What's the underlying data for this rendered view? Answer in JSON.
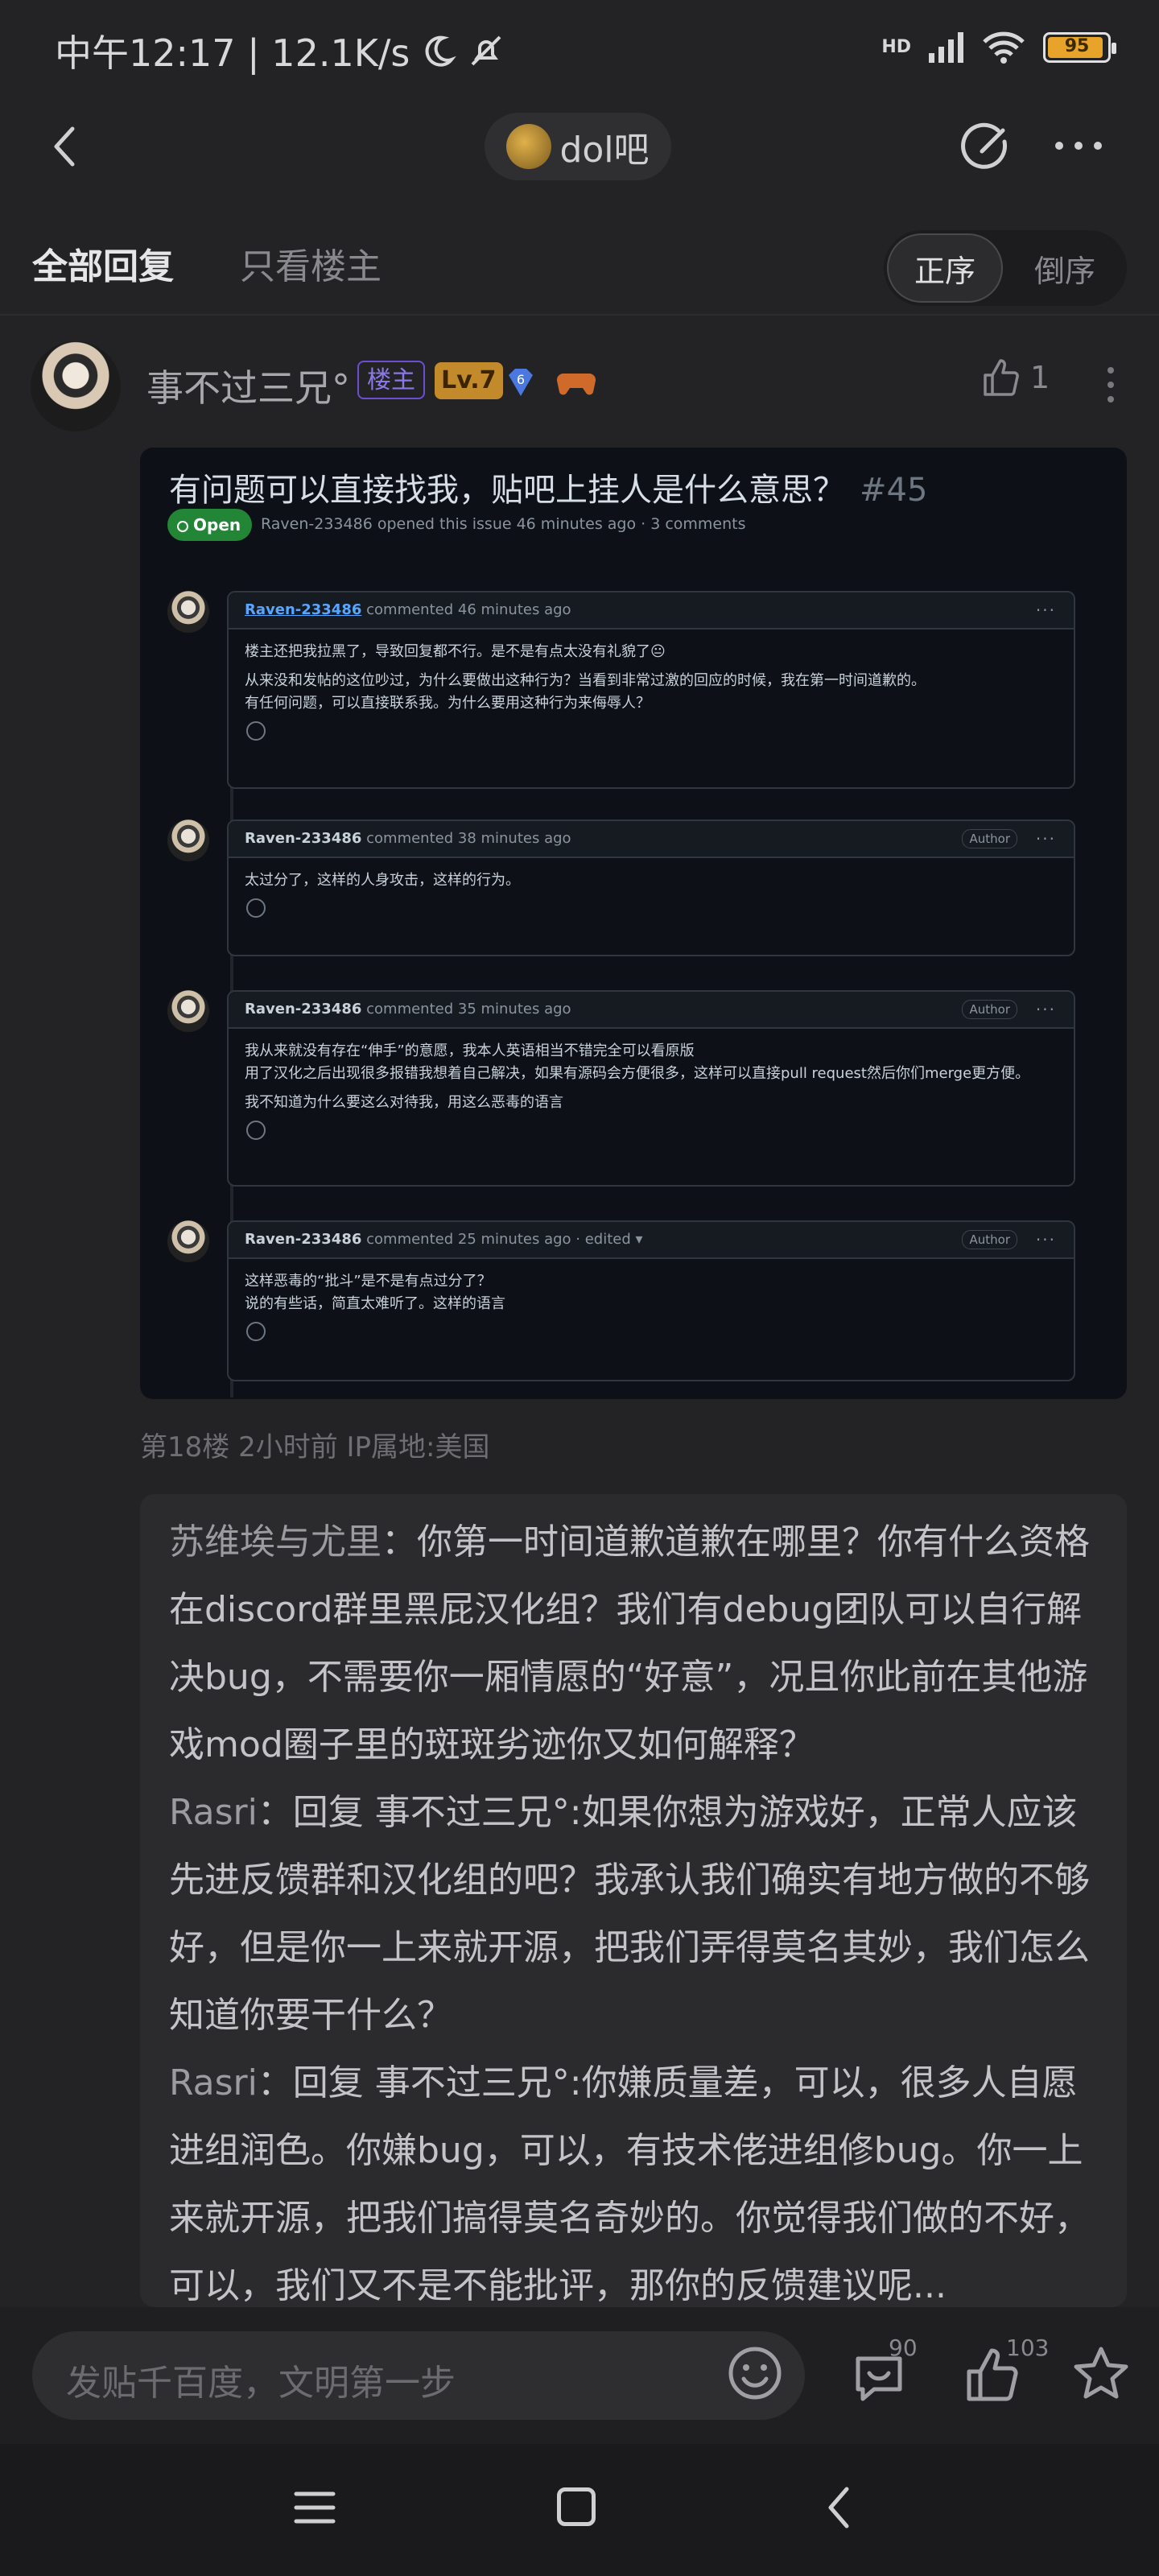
{
  "status_bar": {
    "time_speed": "中午12:17 | 12.1K/s",
    "network": "HD",
    "battery": "95",
    "battery_level": 0.95,
    "icons": [
      "moon-icon",
      "bell-off-icon",
      "signal-icon",
      "wifi-icon",
      "battery-icon"
    ]
  },
  "nav": {
    "forum_name": "dol吧",
    "icons": [
      "back-icon",
      "edit-icon",
      "more-icon"
    ]
  },
  "tabs": {
    "all_replies": "全部回复",
    "only_op": "只看楼主",
    "sort_asc": "正序",
    "sort_desc": "倒序"
  },
  "post": {
    "username": "事不过三兄°",
    "badge_op": "楼主",
    "badge_level": "Lv.7",
    "badge_diamond": "6",
    "like_count": "1",
    "meta": "第18楼  2小时前  IP属地:美国",
    "image": {
      "title": "有问题可以直接找我，贴吧上挂人是什么意思？",
      "issue_number": "#45",
      "status": "Open",
      "meta": "Raven-233486 opened this issue 46 minutes ago · 3 comments",
      "comments": [
        {
          "author": "Raven-233486",
          "time": "commented 46 minutes ago",
          "is_author_badge": "",
          "lines": [
            "楼主还把我拉黑了，导致回复都不行。是不是有点太没有礼貌了😐",
            "从来没和发帖的这位吵过，为什么要做出这种行为？当看到非常过激的回应的时候，我在第一时间道歉的。\n有任何问题，可以直接联系我。为什么要用这种行为来侮辱人？"
          ]
        },
        {
          "author": "Raven-233486",
          "time": "commented 38 minutes ago",
          "is_author_badge": "Author",
          "lines": [
            "太过分了，这样的人身攻击，这样的行为。"
          ]
        },
        {
          "author": "Raven-233486",
          "time": "commented 35 minutes ago",
          "is_author_badge": "Author",
          "lines": [
            "我从来就没有存在“伸手”的意愿，我本人英语相当不错完全可以看原版\n用了汉化之后出现很多报错我想着自己解决，如果有源码会方便很多，这样可以直接pull request然后你们merge更方便。",
            "我不知道为什么要这么对待我，用这么恶毒的语言"
          ]
        },
        {
          "author": "Raven-233486",
          "time": "commented 25 minutes ago · edited ▾",
          "is_author_badge": "Author",
          "lines": [
            "这样恶毒的“批斗”是不是有点过分了？\n说的有些话，简直太难听了。这样的语言"
          ]
        }
      ]
    }
  },
  "replies": [
    {
      "who": "苏维埃与尤里",
      "text": "：你第一时间道歉道歉在哪里？你有什么资格在discord群里黑屁汉化组？我们有debug团队可以自行解决bug，不需要你一厢情愿的“好意”，况且你此前在其他游戏mod圈子里的斑斑劣迹你又如何解释？"
    },
    {
      "who": "Rasri",
      "text": "：回复 事不过三兄°:如果你想为游戏好，正常人应该先进反馈群和汉化组的吧？我承认我们确实有地方做的不够好，但是你一上来就开源，把我们弄得莫名其妙，我们怎么知道你要干什么？"
    },
    {
      "who": "Rasri",
      "text": "：回复 事不过三兄°:你嫌质量差，可以，很多人自愿进组润色。你嫌bug，可以，有技术佬进组修bug。你一上来就开源，把我们搞得莫名奇妙的。你觉得我们做的不好，可以，我们又不是不能批评，那你的反馈建议呢..."
    }
  ],
  "input_bar": {
    "placeholder": "发贴千百度，文明第一步",
    "comment_count": "90",
    "like_count": "103",
    "icons": [
      "emoji-icon",
      "comment-icon",
      "thumb-up-icon",
      "star-icon"
    ]
  },
  "colors": {
    "background": "#232325",
    "accent_lv": "#c28a2a",
    "op_badge": "#6a4fd0",
    "github_open": "#238636",
    "battery": "#e8a42a"
  }
}
